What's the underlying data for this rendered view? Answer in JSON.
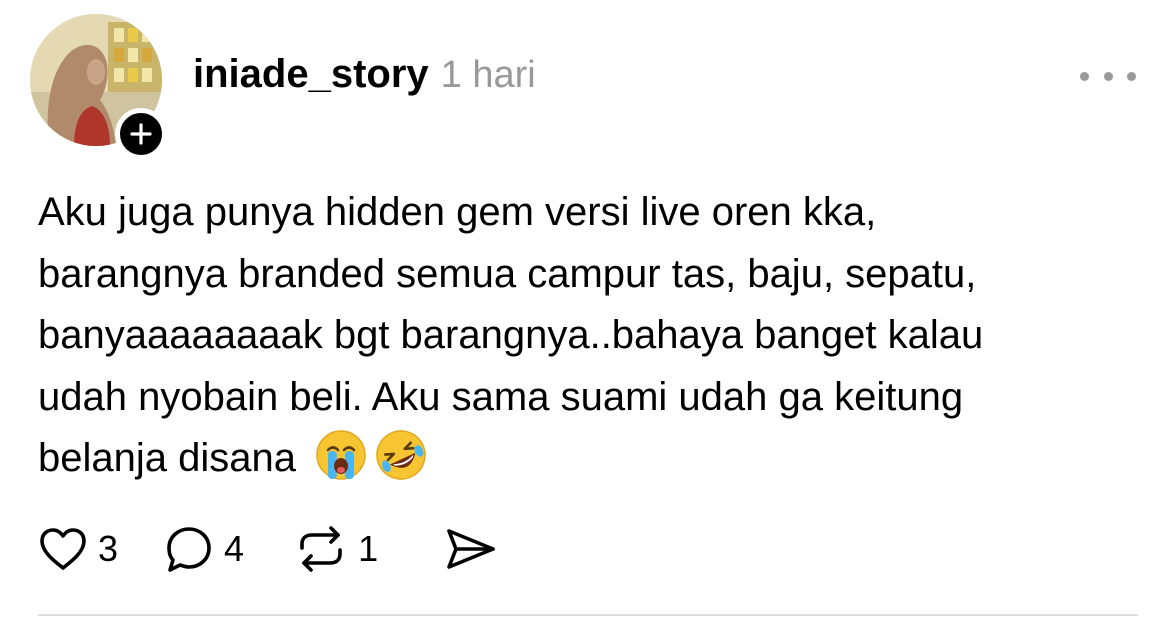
{
  "post": {
    "username": "iniade_story",
    "timestamp": "1 hari",
    "text_line_1": "Aku juga punya hidden gem versi live oren kka,",
    "text_line_2": "barangnya branded semua campur tas, baju, sepatu,",
    "text_line_3": "banyaaaaaaaak bgt barangnya..bahaya banget kalau",
    "text_line_4": "udah nyobain beli. Aku sama suami udah ga keitung",
    "text_line_5": "belanja disana",
    "emojis": [
      "loudly-crying-face",
      "rolling-on-the-floor-laughing"
    ]
  },
  "actions": {
    "like_count": "3",
    "reply_count": "4",
    "repost_count": "1"
  },
  "icons": {
    "like": "heart-icon",
    "reply": "speech-bubble-icon",
    "repost": "repost-icon",
    "share": "send-icon",
    "more": "more-dots-icon",
    "follow": "plus-icon"
  },
  "colors": {
    "text": "#000000",
    "secondary_text": "#999999",
    "divider": "#dcdcdc",
    "badge": "#000000"
  }
}
